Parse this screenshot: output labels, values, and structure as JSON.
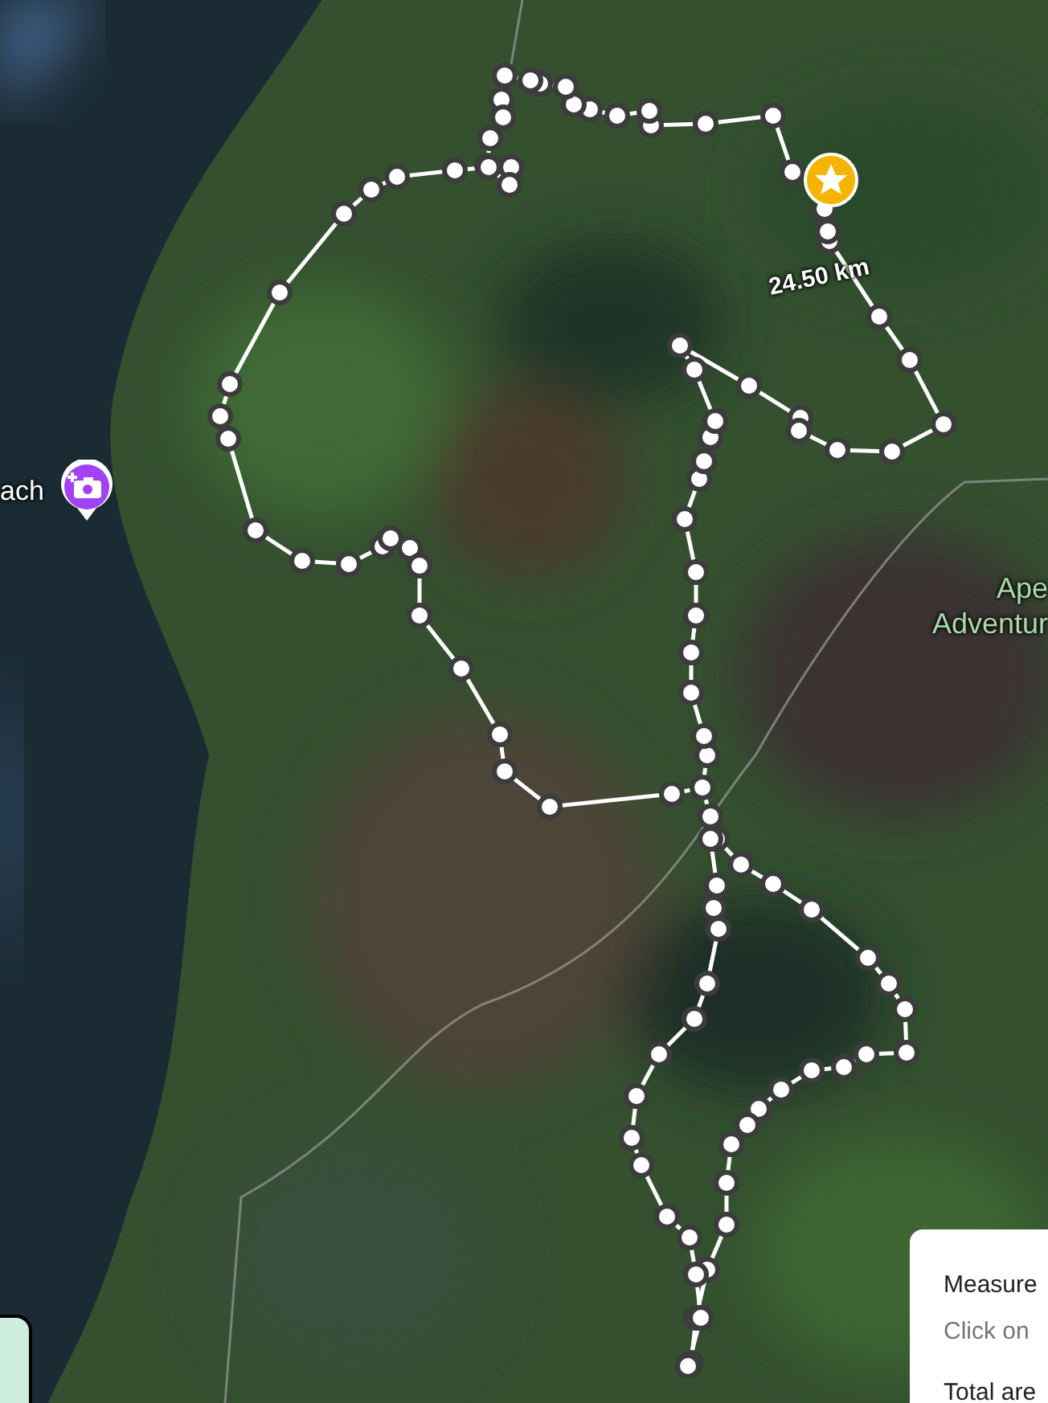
{
  "map": {
    "places": [
      {
        "kind": "photo",
        "lines": [
          "ach"
        ]
      },
      {
        "kind": "area",
        "lines": [
          "Ape",
          "Adventur"
        ]
      }
    ],
    "route": {
      "distance": "24.50 km"
    }
  },
  "measure_card": {
    "title": "Measure",
    "hint": "Click on",
    "total": "Total are"
  }
}
